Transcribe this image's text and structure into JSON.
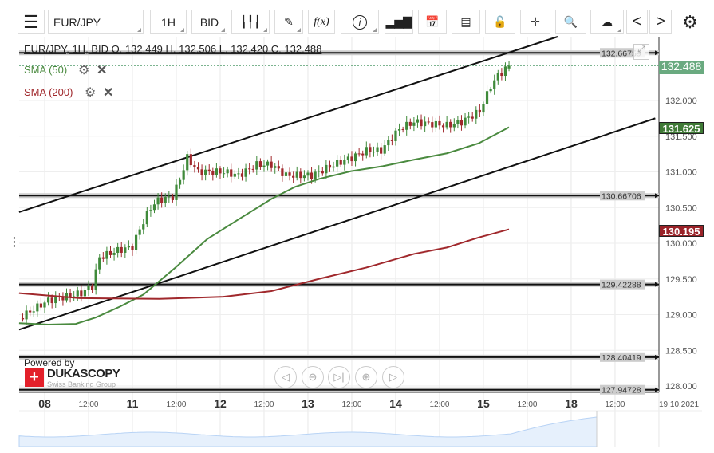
{
  "toolbar": {
    "instrument": "EUR/JPY",
    "period": "1H",
    "side": "BID",
    "function_label": "f(x)",
    "prev_label": "<",
    "next_label": ">"
  },
  "chart_header": "EUR/JPY, 1H, BID   O. 132.449 H. 132.506 L. 132.420 C. 132.488",
  "indicators": [
    {
      "label": "SMA (50)",
      "color": "#4a8a3f"
    },
    {
      "label": "SMA (200)",
      "color": "#a0282c"
    }
  ],
  "colors": {
    "bull": "#3f8a3a",
    "bear": "#a0282c",
    "last_price": "#6aaa80",
    "sma50": "#4a8a3f",
    "sma200": "#a0282c"
  },
  "branding": {
    "powered_by": "Powered by",
    "name": "DUKASCOPY",
    "tagline": "Swiss Banking Group"
  },
  "chart_data": {
    "type": "candlestick",
    "title": "EUR/JPY, 1H, BID",
    "ohlc_last": {
      "open": 132.449,
      "high": 132.506,
      "low": 132.42,
      "close": 132.488
    },
    "x_unit": "hours since 08 00:00",
    "x_ticks": [
      {
        "h": 0,
        "label": "08",
        "major": true
      },
      {
        "h": 12,
        "label": "12:00"
      },
      {
        "h": 24,
        "label": "11",
        "major": true
      },
      {
        "h": 36,
        "label": "12:00"
      },
      {
        "h": 48,
        "label": "12",
        "major": true
      },
      {
        "h": 60,
        "label": "12:00"
      },
      {
        "h": 72,
        "label": "13",
        "major": true
      },
      {
        "h": 84,
        "label": "12:00"
      },
      {
        "h": 96,
        "label": "14",
        "major": true
      },
      {
        "h": 108,
        "label": "12:00"
      },
      {
        "h": 120,
        "label": "15",
        "major": true
      },
      {
        "h": 132,
        "label": "12:00"
      },
      {
        "h": 144,
        "label": "18",
        "major": true
      },
      {
        "h": 156,
        "label": "12:00"
      },
      {
        "h": 168,
        "label": "19.10.2021"
      }
    ],
    "ylim": [
      127.9,
      132.9
    ],
    "y_ticks": [
      "132.000",
      "131.500",
      "131.000",
      "130.500",
      "130.000",
      "129.500",
      "129.000",
      "128.500",
      "128.000"
    ],
    "close_anchors": [
      [
        -7,
        128.95
      ],
      [
        1,
        129.2
      ],
      [
        10,
        129.3
      ],
      [
        13,
        129.4
      ],
      [
        15,
        129.8
      ],
      [
        20,
        129.9
      ],
      [
        24,
        129.95
      ],
      [
        26,
        130.2
      ],
      [
        29,
        130.5
      ],
      [
        31,
        130.6
      ],
      [
        35,
        130.65
      ],
      [
        37,
        130.9
      ],
      [
        39,
        131.2
      ],
      [
        42,
        131.0
      ],
      [
        49,
        131.0
      ],
      [
        53,
        130.95
      ],
      [
        58,
        131.1
      ],
      [
        62,
        131.1
      ],
      [
        66,
        130.95
      ],
      [
        73,
        130.95
      ],
      [
        79,
        131.1
      ],
      [
        84,
        131.2
      ],
      [
        88,
        131.3
      ],
      [
        92,
        131.3
      ],
      [
        97,
        131.6
      ],
      [
        101,
        131.7
      ],
      [
        110,
        131.65
      ],
      [
        114,
        131.7
      ],
      [
        119,
        131.85
      ],
      [
        122,
        132.2
      ],
      [
        124,
        132.35
      ],
      [
        127,
        132.488
      ]
    ],
    "sma50": [
      [
        -7,
        128.88
      ],
      [
        1,
        128.86
      ],
      [
        8.5,
        128.87
      ],
      [
        14,
        128.96
      ],
      [
        20.5,
        129.11
      ],
      [
        27,
        129.28
      ],
      [
        35.8,
        129.66
      ],
      [
        44.5,
        130.06
      ],
      [
        53.2,
        130.34
      ],
      [
        62,
        130.62
      ],
      [
        68.5,
        130.79
      ],
      [
        75,
        130.9
      ],
      [
        83.8,
        131.01
      ],
      [
        92.5,
        131.08
      ],
      [
        101,
        131.17
      ],
      [
        110,
        131.26
      ],
      [
        118.7,
        131.4
      ],
      [
        127,
        131.625
      ]
    ],
    "sma200": [
      [
        -7,
        129.3
      ],
      [
        9.6,
        129.23
      ],
      [
        31.4,
        129.22
      ],
      [
        48.9,
        129.25
      ],
      [
        62,
        129.33
      ],
      [
        75,
        129.5
      ],
      [
        88,
        129.66
      ],
      [
        101,
        129.85
      ],
      [
        110,
        129.94
      ],
      [
        118.7,
        130.08
      ],
      [
        127,
        130.195
      ]
    ],
    "trend_lines": [
      [
        [
          -7,
          130.436
        ],
        [
          140.3,
          132.894
        ]
      ],
      [
        [
          -7,
          128.79
        ],
        [
          167,
          131.75
        ]
      ]
    ],
    "horizontal_levels": [
      "132.66759",
      "130.66706",
      "129.42288",
      "128.40419",
      "127.94728"
    ],
    "price_labels": {
      "last": "132.488",
      "sma50": "131.625",
      "sma200": "130.195"
    }
  }
}
